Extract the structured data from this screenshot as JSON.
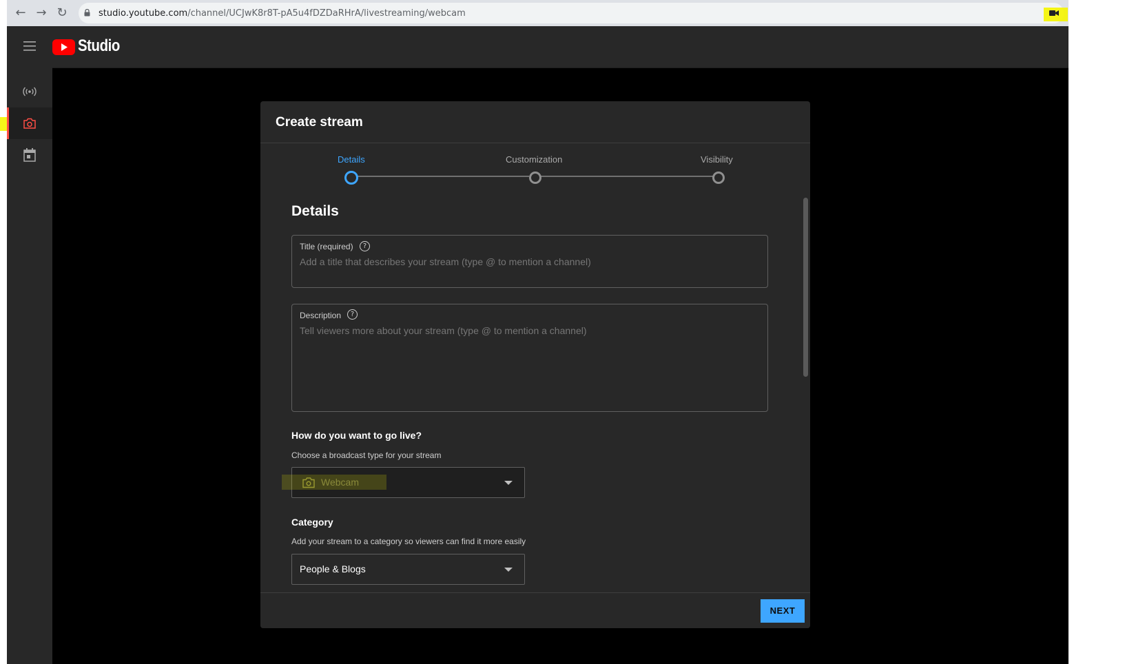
{
  "browser": {
    "url_host": "studio.youtube.com",
    "url_path": "/channel/UCJwK8r8T-pA5u4fDZDaRHrA/livestreaming/webcam"
  },
  "header": {
    "logo_text": "Studio"
  },
  "sidebar": {
    "items": [
      {
        "name": "stream",
        "icon": "broadcast-icon"
      },
      {
        "name": "webcam",
        "icon": "camera-icon",
        "active": true
      },
      {
        "name": "manage",
        "icon": "calendar-icon"
      }
    ]
  },
  "modal": {
    "title": "Create stream",
    "steps": [
      "Details",
      "Customization",
      "Visibility"
    ],
    "active_step": 0,
    "section_title": "Details",
    "title_field": {
      "label": "Title (required)",
      "placeholder": "Add a title that describes your stream (type @ to mention a channel)"
    },
    "description_field": {
      "label": "Description",
      "placeholder": "Tell viewers more about your stream (type @ to mention a channel)"
    },
    "broadcast": {
      "heading": "How do you want to go live?",
      "subtext": "Choose a broadcast type for your stream",
      "selected": "Webcam"
    },
    "category": {
      "heading": "Category",
      "subtext": "Add your stream to a category so viewers can find it more easily",
      "selected": "People & Blogs"
    },
    "next_label": "NEXT"
  },
  "colors": {
    "accent_blue": "#3ea6ff",
    "youtube_red": "#ff0000",
    "highlight_yellow": "#f5f500",
    "surface": "#282828"
  }
}
